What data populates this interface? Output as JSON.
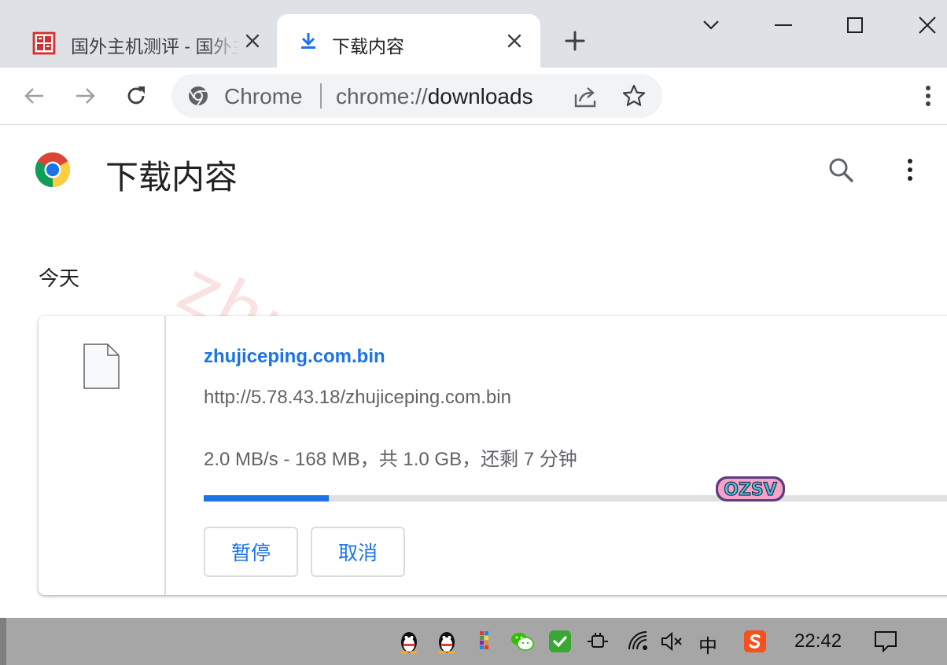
{
  "tabs": [
    {
      "title": "国外主机测评 - 国外主机测评",
      "active": false,
      "favicon": "red-seal-icon"
    },
    {
      "title": "下载内容",
      "active": true,
      "favicon": "download-icon"
    }
  ],
  "toolbar": {
    "site_label": "Chrome",
    "url_scheme": "chrome://",
    "url_path": "downloads"
  },
  "page": {
    "title": "下载内容",
    "watermark": "zhujiceping.com",
    "date_header": "今天"
  },
  "download": {
    "file_name": "zhujiceping.com.bin",
    "url": "http://5.78.43.18/zhujiceping.com.bin",
    "status": "2.0 MB/s - 168 MB，共 1.0 GB，还剩 7 分钟",
    "progress": 0.164,
    "pause_label": "暂停",
    "cancel_label": "取消",
    "sticker_text": "OZSV"
  },
  "taskbar": {
    "ime": "中",
    "clock": "22:42"
  },
  "colors": {
    "accent": "#1a73e8",
    "tabstrip": "#dee1e6",
    "omnibox": "#f1f3f4",
    "taskbar": "#a6a6a6"
  }
}
